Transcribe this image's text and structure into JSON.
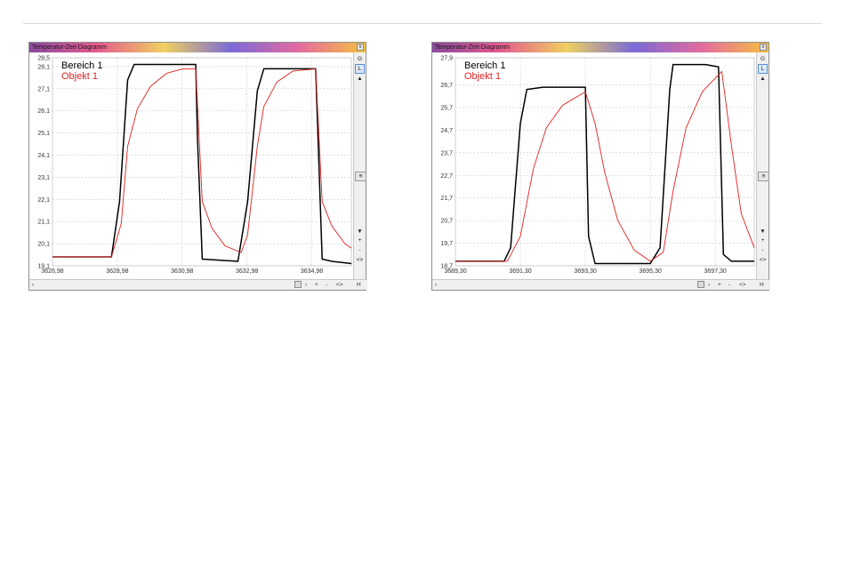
{
  "windows": [
    {
      "title": "Temperatur-Zeit-Diagramm",
      "close_label": "x",
      "legend": [
        "Bereich 1",
        "Objekt 1"
      ],
      "right_buttons": [
        "G",
        "L",
        "▲",
        "≡",
        "▼",
        "+",
        "-",
        "<>"
      ],
      "bottom_buttons": [
        "›",
        "+",
        "-",
        "<>",
        "H"
      ],
      "left_arrow": "‹",
      "chart_data": {
        "type": "line",
        "ylim": [
          19.1,
          28.5
        ],
        "ytick_labels": [
          "28,5",
          "28,1",
          "27,1",
          "26,1",
          "25,1",
          "24,1",
          "23,1",
          "22,1",
          "21,1",
          "20,1",
          "19,1"
        ],
        "yticks": [
          28.5,
          28.1,
          27.1,
          26.1,
          25.1,
          24.1,
          23.1,
          22.1,
          21.1,
          20.1,
          19.1
        ],
        "xlim": [
          3626.98,
          3636.2
        ],
        "xtick_labels": [
          "3626,98",
          "3628,98",
          "3630,98",
          "3632,98",
          "3634,98"
        ],
        "xticks": [
          3626.98,
          3628.98,
          3630.98,
          3632.98,
          3634.98
        ],
        "series": [
          {
            "name": "Bereich 1",
            "color": "#000000",
            "x": [
              3626.98,
              3628.8,
              3629.05,
              3629.3,
              3629.5,
              3631.4,
              3631.45,
              3631.6,
              3632.7,
              3633.0,
              3633.3,
              3633.5,
              3635.1,
              3635.3,
              3635.6,
              3636.2
            ],
            "y": [
              19.5,
              19.5,
              22.0,
              27.5,
              28.2,
              28.2,
              25.0,
              19.4,
              19.3,
              22.0,
              27.0,
              28.0,
              28.0,
              19.4,
              19.3,
              19.2
            ]
          },
          {
            "name": "Objekt 1",
            "color": "#e02020",
            "x": [
              3626.98,
              3628.8,
              3629.1,
              3629.3,
              3629.6,
              3630.0,
              3630.5,
              3631.0,
              3631.4,
              3631.6,
              3631.9,
              3632.3,
              3632.8,
              3633.0,
              3633.3,
              3633.5,
              3633.9,
              3634.4,
              3635.1,
              3635.3,
              3635.6,
              3636.0,
              3636.2
            ],
            "y": [
              19.5,
              19.5,
              21.0,
              24.5,
              26.2,
              27.2,
              27.8,
              28.0,
              28.0,
              22.0,
              20.8,
              20.0,
              19.7,
              20.5,
              24.5,
              26.3,
              27.4,
              27.9,
              28.0,
              22.0,
              20.9,
              20.1,
              19.9
            ]
          }
        ]
      }
    },
    {
      "title": "Temperatur-Zeit-Diagramm",
      "close_label": "x",
      "legend": [
        "Bereich 1",
        "Objekt 1"
      ],
      "right_buttons": [
        "G",
        "L",
        "▲",
        "≡",
        "▼",
        "+",
        "-",
        "<>"
      ],
      "bottom_buttons": [
        "›",
        "+",
        "-",
        "<>",
        "H"
      ],
      "left_arrow": "‹",
      "chart_data": {
        "type": "line",
        "ylim": [
          18.7,
          27.9
        ],
        "ytick_labels": [
          "27,9",
          "26,7",
          "25,7",
          "24,7",
          "23,7",
          "22,7",
          "21,7",
          "20,7",
          "19,7",
          "18,7"
        ],
        "yticks": [
          27.9,
          26.7,
          25.7,
          24.7,
          23.7,
          22.7,
          21.7,
          20.7,
          19.7,
          18.7
        ],
        "xlim": [
          3689.3,
          3698.5
        ],
        "xtick_labels": [
          "3689,30",
          "3691,30",
          "3693,30",
          "3695,30",
          "3697,30"
        ],
        "xticks": [
          3689.3,
          3691.3,
          3693.3,
          3695.3,
          3697.3
        ],
        "series": [
          {
            "name": "Bereich 1",
            "color": "#000000",
            "x": [
              3689.3,
              3690.8,
              3691.0,
              3691.3,
              3691.5,
              3692.0,
              3693.3,
              3693.4,
              3693.6,
              3695.3,
              3695.6,
              3695.9,
              3696.0,
              3697.0,
              3697.4,
              3697.55,
              3697.8,
              3698.5
            ],
            "y": [
              18.9,
              18.9,
              19.5,
              25.0,
              26.5,
              26.6,
              26.6,
              20.0,
              18.8,
              18.8,
              19.5,
              26.5,
              27.6,
              27.6,
              27.5,
              19.2,
              18.9,
              18.9
            ]
          },
          {
            "name": "Objekt 1",
            "color": "#e02020",
            "x": [
              3689.3,
              3690.9,
              3691.3,
              3691.7,
              3692.1,
              3692.6,
              3693.3,
              3693.6,
              3693.9,
              3694.3,
              3694.8,
              3695.3,
              3695.7,
              3696.0,
              3696.4,
              3696.9,
              3697.5,
              3697.8,
              3698.1,
              3698.5
            ],
            "y": [
              18.9,
              18.9,
              20.0,
              23.0,
              24.8,
              25.8,
              26.4,
              25.0,
              22.8,
              20.7,
              19.4,
              18.9,
              19.3,
              22.0,
              24.8,
              26.4,
              27.3,
              24.0,
              21.0,
              19.5
            ]
          }
        ]
      }
    }
  ]
}
